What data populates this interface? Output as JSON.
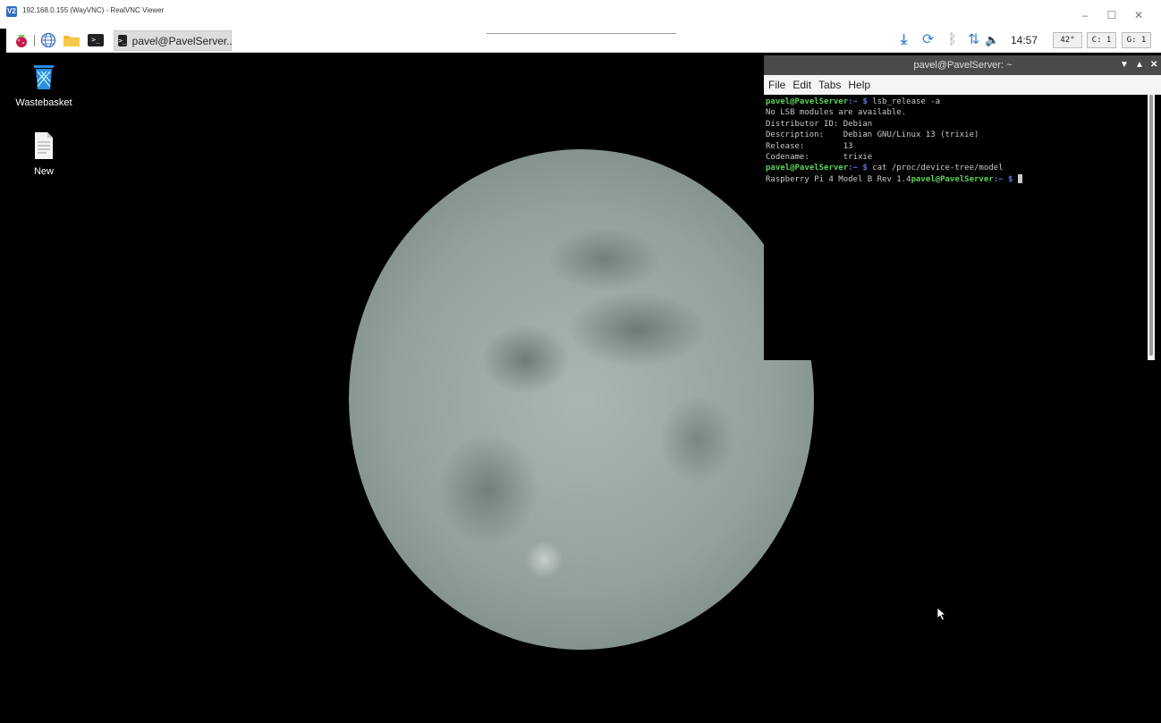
{
  "vnc_window": {
    "title": "192.168.0.155 (WayVNC) - RealVNC Viewer",
    "logo_text": "V2",
    "minimize": "–",
    "maximize": "☐",
    "close": "✕"
  },
  "panel": {
    "menu_icon": "raspberry-icon",
    "launchers": [
      "browser-icon",
      "file-manager-icon",
      "terminal-icon"
    ],
    "task_button": {
      "icon_text": ">_",
      "label": "pavel@PavelServer.."
    },
    "tray": {
      "download": "⤓",
      "sync": "⟳",
      "bluetooth": "ᛒ",
      "network": "⇅",
      "volume": "🔈",
      "clock": "14:57"
    },
    "monitors": {
      "temp": "42°",
      "cpu": "C: 1",
      "gpu": "G: 1"
    }
  },
  "desktop_icons": [
    {
      "name": "Wastebasket"
    },
    {
      "name": "New"
    }
  ],
  "terminal": {
    "title": "pavel@PavelServer: ~",
    "menu": [
      "File",
      "Edit",
      "Tabs",
      "Help"
    ],
    "prompt_user": "pavel@PavelServer",
    "prompt_sep": ":~ $ ",
    "cmd1": "lsb_release -a",
    "out1": "No LSB modules are available.",
    "out2": "Distributor ID: Debian",
    "out3": "Description:    Debian GNU/Linux 13 (trixie)",
    "out4": "Release:        13",
    "out5": "Codename:       trixie",
    "cmd2": "cat /proc/device-tree/model",
    "out6": "Raspberry Pi 4 Model B Rev 1.4"
  }
}
